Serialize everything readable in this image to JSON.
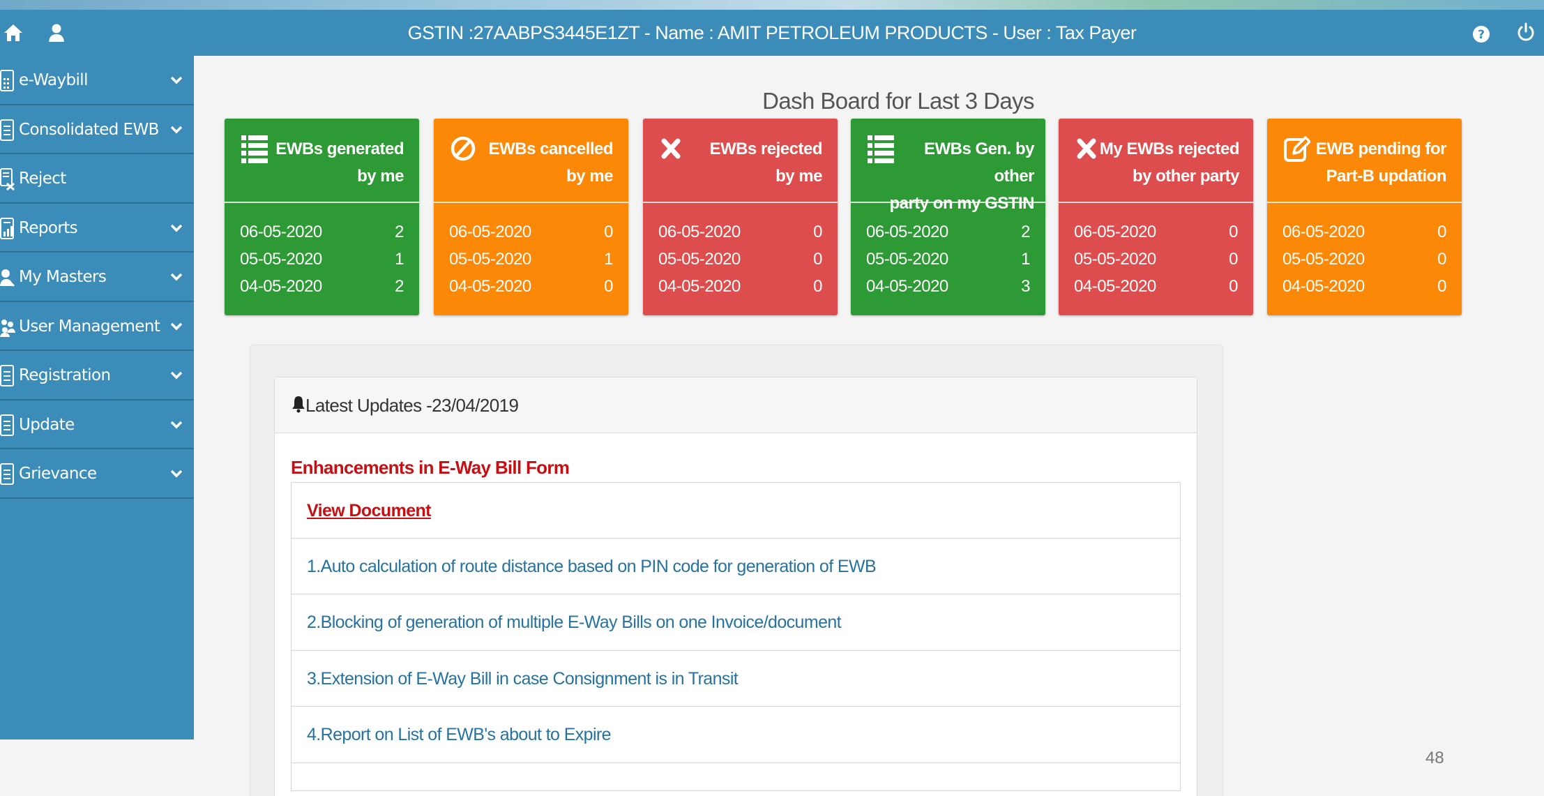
{
  "header": {
    "title": "GSTIN :27AABPS3445E1ZT - Name : AMIT PETROLEUM PRODUCTS - User : Tax Payer",
    "icons": [
      "home-icon",
      "user-icon",
      "help-icon",
      "power-icon"
    ]
  },
  "sidebar": {
    "items": [
      {
        "label": "e-Waybill",
        "icon": "document-icon",
        "has_submenu": true
      },
      {
        "label": "Consolidated EWB",
        "icon": "document-icon",
        "has_submenu": true
      },
      {
        "label": "Reject",
        "icon": "reject-icon",
        "has_submenu": false
      },
      {
        "label": "Reports",
        "icon": "report-icon",
        "has_submenu": true
      },
      {
        "label": "My Masters",
        "icon": "masters-icon",
        "has_submenu": true
      },
      {
        "label": "User Management",
        "icon": "users-icon",
        "has_submenu": true
      },
      {
        "label": "Registration",
        "icon": "document-icon",
        "has_submenu": true
      },
      {
        "label": "Update",
        "icon": "document-icon",
        "has_submenu": true
      },
      {
        "label": "Grievance",
        "icon": "document-icon",
        "has_submenu": true
      }
    ]
  },
  "dashboard": {
    "title": "Dash Board for Last 3 Days",
    "cards": [
      {
        "title_line1": "EWBs generated",
        "title_line2": "by me",
        "color": "#2d9a35",
        "icon": "list-icon",
        "rows": [
          {
            "date": "06-05-2020",
            "value": "2"
          },
          {
            "date": "05-05-2020",
            "value": "1"
          },
          {
            "date": "04-05-2020",
            "value": "2"
          }
        ]
      },
      {
        "title_line1": "EWBs cancelled",
        "title_line2": "by me",
        "color": "#fb8807",
        "icon": "ban-icon",
        "rows": [
          {
            "date": "06-05-2020",
            "value": "0"
          },
          {
            "date": "05-05-2020",
            "value": "1"
          },
          {
            "date": "04-05-2020",
            "value": "0"
          }
        ]
      },
      {
        "title_line1": "EWBs rejected",
        "title_line2": "by me",
        "color": "#de4d4d",
        "icon": "close-icon",
        "rows": [
          {
            "date": "06-05-2020",
            "value": "0"
          },
          {
            "date": "05-05-2020",
            "value": "0"
          },
          {
            "date": "04-05-2020",
            "value": "0"
          }
        ]
      },
      {
        "title_line1": "EWBs Gen. by other",
        "title_line2": "party on my GSTIN",
        "color": "#2d9a35",
        "icon": "list-icon",
        "rows": [
          {
            "date": "06-05-2020",
            "value": "2"
          },
          {
            "date": "05-05-2020",
            "value": "1"
          },
          {
            "date": "04-05-2020",
            "value": "3"
          }
        ]
      },
      {
        "title_line1": "My EWBs rejected",
        "title_line2": "by other party",
        "color": "#de4d4d",
        "icon": "close-icon",
        "rows": [
          {
            "date": "06-05-2020",
            "value": "0"
          },
          {
            "date": "05-05-2020",
            "value": "0"
          },
          {
            "date": "04-05-2020",
            "value": "0"
          }
        ]
      },
      {
        "title_line1": "EWB pending for",
        "title_line2": "Part-B updation",
        "color": "#fb8807",
        "icon": "edit-icon",
        "rows": [
          {
            "date": "06-05-2020",
            "value": "0"
          },
          {
            "date": "05-05-2020",
            "value": "0"
          },
          {
            "date": "04-05-2020",
            "value": "0"
          }
        ]
      }
    ]
  },
  "updates": {
    "title": "Latest Updates -23/04/2019",
    "section_title": "Enhancements in E-Way Bill Form",
    "view_document": "View Document",
    "items": [
      "1.Auto calculation of route distance based on PIN code for generation of EWB",
      "2.Blocking of generation of multiple E-Way Bills on one Invoice/document",
      "3.Extension of E-Way Bill in case Consignment is in Transit",
      "4.Report on List of EWB's about to Expire",
      ""
    ]
  },
  "page_number": "48"
}
